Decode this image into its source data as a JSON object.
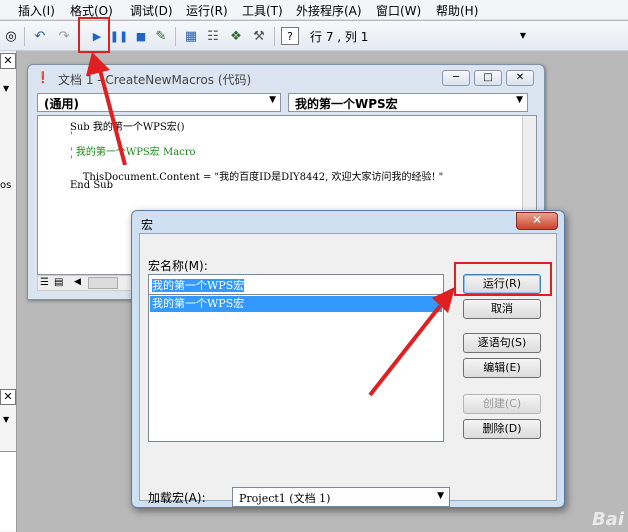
{
  "menu": {
    "items": [
      "插入(I)",
      "格式(O)",
      "调试(D)",
      "运行(R)",
      "工具(T)",
      "外接程序(A)",
      "窗口(W)",
      "帮助(H)"
    ]
  },
  "toolbar": {
    "position": "行 7 , 列 1"
  },
  "code_window": {
    "title": "文档 1 - CreateNewMacros (代码)",
    "object_combo": "(通用)",
    "proc_combo": "我的第一个WPS宏",
    "lines": [
      "Sub 我的第一个WPS宏()",
      "'",
      "' 我的第一个WPS宏 Macro",
      "'",
      "    ThisDocument.Content = \"我的百度ID是DIY8442, 欢迎大家访问我的经验! \"",
      "End Sub"
    ]
  },
  "dialog": {
    "title": "宏",
    "name_label": "宏名称(M):",
    "name_value": "我的第一个WPS宏",
    "list_items": [
      "我的第一个WPS宏"
    ],
    "buttons": {
      "run": "运行(R)",
      "cancel": "取消",
      "step": "逐语句(S)",
      "edit": "编辑(E)",
      "create": "创建(C)",
      "delete": "删除(D)"
    },
    "load_label": "加载宏(A):",
    "load_value": "Project1 (文档 1)"
  },
  "left_pane": {
    "label": "os"
  },
  "watermark": "Bai"
}
